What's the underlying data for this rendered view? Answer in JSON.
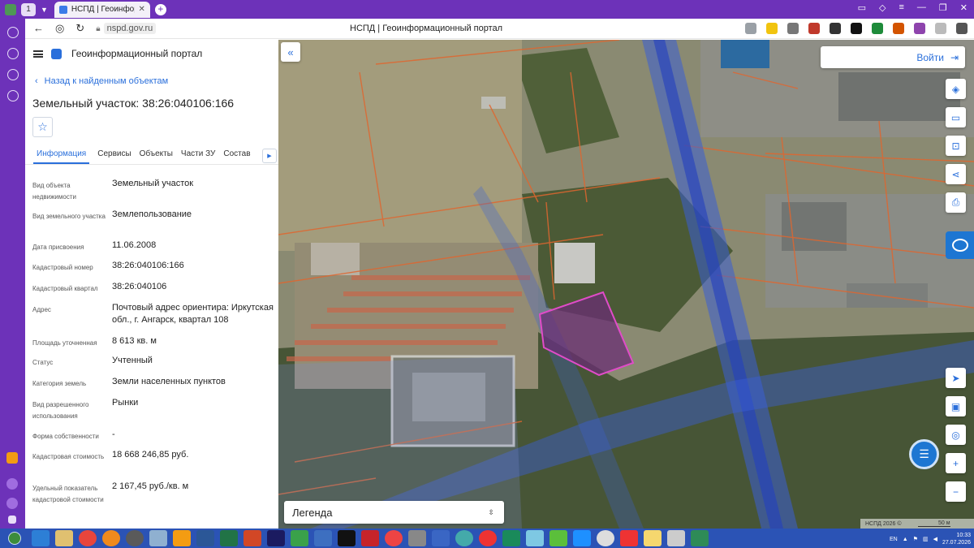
{
  "browser": {
    "tab_count": "1",
    "tab_title": "НСПД | Геоинформацио",
    "url": "nspd.gov.ru",
    "page_title": "НСПД | Геоинформационный портал"
  },
  "header": {
    "portal": "Геоинформационный портал"
  },
  "nav": {
    "back": "Назад к найденным объектам"
  },
  "object": {
    "title": "Земельный участок: 38:26:040106:166"
  },
  "tabs": [
    "Информация",
    "Сервисы",
    "Объекты",
    "Части ЗУ",
    "Состав"
  ],
  "details": [
    {
      "label": "Вид объекта недвижимости",
      "value": "Земельный участок"
    },
    {
      "label": "Вид земельного участка",
      "value": "Землепользование"
    },
    {
      "label": "Дата присвоения",
      "value": "11.06.2008"
    },
    {
      "label": "Кадастровый номер",
      "value": "38:26:040106:166"
    },
    {
      "label": "Кадастровый квартал",
      "value": "38:26:040106"
    },
    {
      "label": "Адрес",
      "value": "Почтовый адрес ориентира: Иркутская обл., г. Ангарск, квартал 108"
    },
    {
      "label": "Площадь уточненная",
      "value": "8 613 кв. м"
    },
    {
      "label": "Статус",
      "value": "Учтенный"
    },
    {
      "label": "Категория земель",
      "value": "Земли населенных пунктов"
    },
    {
      "label": "Вид разрешенного использования",
      "value": "Рынки"
    },
    {
      "label": "Форма собственности",
      "value": "-"
    },
    {
      "label": "Кадастровая стоимость",
      "value": "18 668 246,85 руб."
    },
    {
      "label": "Удельный показатель кадастровой стоимости",
      "value": "2 167,45 руб./кв. м"
    }
  ],
  "map": {
    "login": "Войти",
    "legend": "Легенда",
    "copyright": "НСПД 2026 ©",
    "scale": "50 м"
  },
  "taskbar": {
    "lang": "EN",
    "time": "10:33",
    "date": "27.07.2026"
  },
  "colors": {
    "accent": "#2a6fdb",
    "browser": "#6d32b9",
    "taskbar": "#2b53b5",
    "parcel": "#c0309a"
  }
}
